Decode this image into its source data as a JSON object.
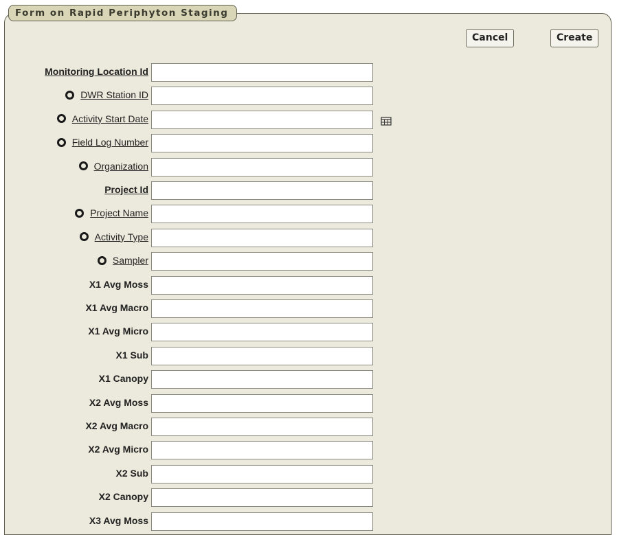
{
  "region": {
    "title": "Form on Rapid Periphyton Staging"
  },
  "buttons": {
    "cancel": "Cancel",
    "create": "Create"
  },
  "fields": [
    {
      "label": "Monitoring Location Id",
      "style": "req",
      "help": false,
      "value": ""
    },
    {
      "label": "DWR Station ID",
      "style": "opt",
      "help": true,
      "value": ""
    },
    {
      "label": "Activity Start Date",
      "style": "opt",
      "help": true,
      "value": "",
      "date_picker": true
    },
    {
      "label": "Field Log Number",
      "style": "opt",
      "help": true,
      "value": ""
    },
    {
      "label": "Organization",
      "style": "opt",
      "help": true,
      "value": ""
    },
    {
      "label": "Project Id",
      "style": "req",
      "help": false,
      "value": ""
    },
    {
      "label": "Project Name",
      "style": "opt",
      "help": true,
      "value": ""
    },
    {
      "label": "Activity Type",
      "style": "opt",
      "help": true,
      "value": ""
    },
    {
      "label": "Sampler",
      "style": "opt",
      "help": true,
      "value": ""
    },
    {
      "label": "X1 Avg Moss",
      "style": "plain",
      "help": false,
      "value": ""
    },
    {
      "label": "X1 Avg Macro",
      "style": "plain",
      "help": false,
      "value": ""
    },
    {
      "label": "X1 Avg Micro",
      "style": "plain",
      "help": false,
      "value": ""
    },
    {
      "label": "X1 Sub",
      "style": "plain",
      "help": false,
      "value": ""
    },
    {
      "label": "X1 Canopy",
      "style": "plain",
      "help": false,
      "value": ""
    },
    {
      "label": "X2 Avg Moss",
      "style": "plain",
      "help": false,
      "value": ""
    },
    {
      "label": "X2 Avg Macro",
      "style": "plain",
      "help": false,
      "value": ""
    },
    {
      "label": "X2 Avg Micro",
      "style": "plain",
      "help": false,
      "value": ""
    },
    {
      "label": "X2 Sub",
      "style": "plain",
      "help": false,
      "value": ""
    },
    {
      "label": "X2 Canopy",
      "style": "plain",
      "help": false,
      "value": ""
    },
    {
      "label": "X3 Avg Moss",
      "style": "plain",
      "help": false,
      "value": ""
    }
  ],
  "icons": {
    "help": "help-circle-icon",
    "date": "calendar-icon"
  },
  "colors": {
    "region_bg": "#eceadc",
    "title_bg": "#d9d6b8",
    "border": "#5f5e4e"
  }
}
